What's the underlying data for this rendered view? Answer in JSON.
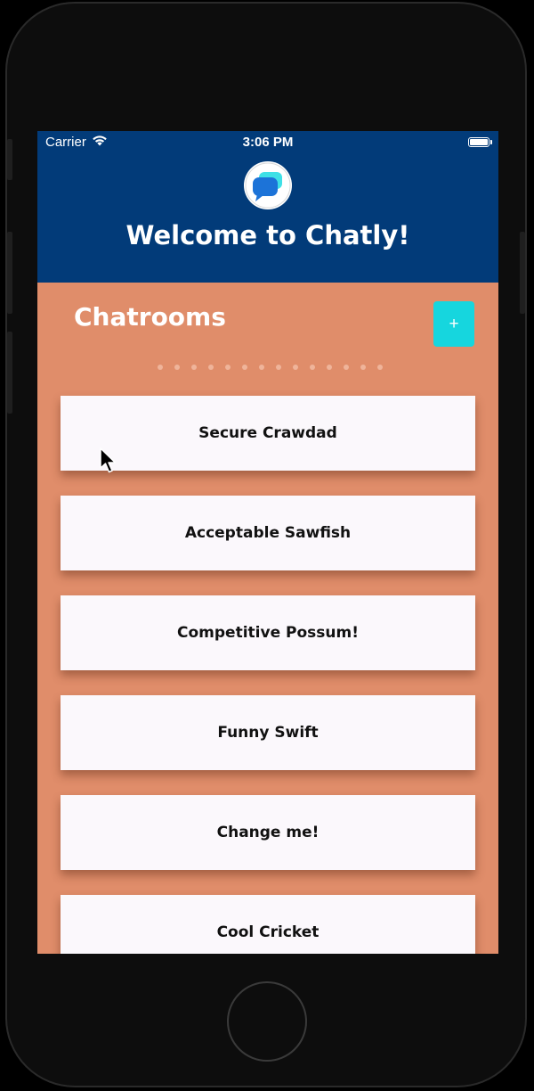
{
  "status_bar": {
    "carrier": "Carrier",
    "time": "3:06 PM",
    "wifi_icon": "wifi-icon",
    "battery_icon": "battery-icon"
  },
  "header": {
    "logo_icon": "chat-bubbles-logo",
    "title": "Welcome to Chatly!",
    "background_color": "#023B79"
  },
  "chatrooms": {
    "title": "Chatrooms",
    "add_button_label": "+",
    "add_button_color": "#16D6DE",
    "background_color": "#E08D6A",
    "rooms": [
      {
        "name": "Secure Crawdad"
      },
      {
        "name": "Acceptable Sawfish"
      },
      {
        "name": "Competitive Possum!"
      },
      {
        "name": "Funny Swift"
      },
      {
        "name": "Change me!"
      },
      {
        "name": "Cool Cricket"
      }
    ]
  }
}
